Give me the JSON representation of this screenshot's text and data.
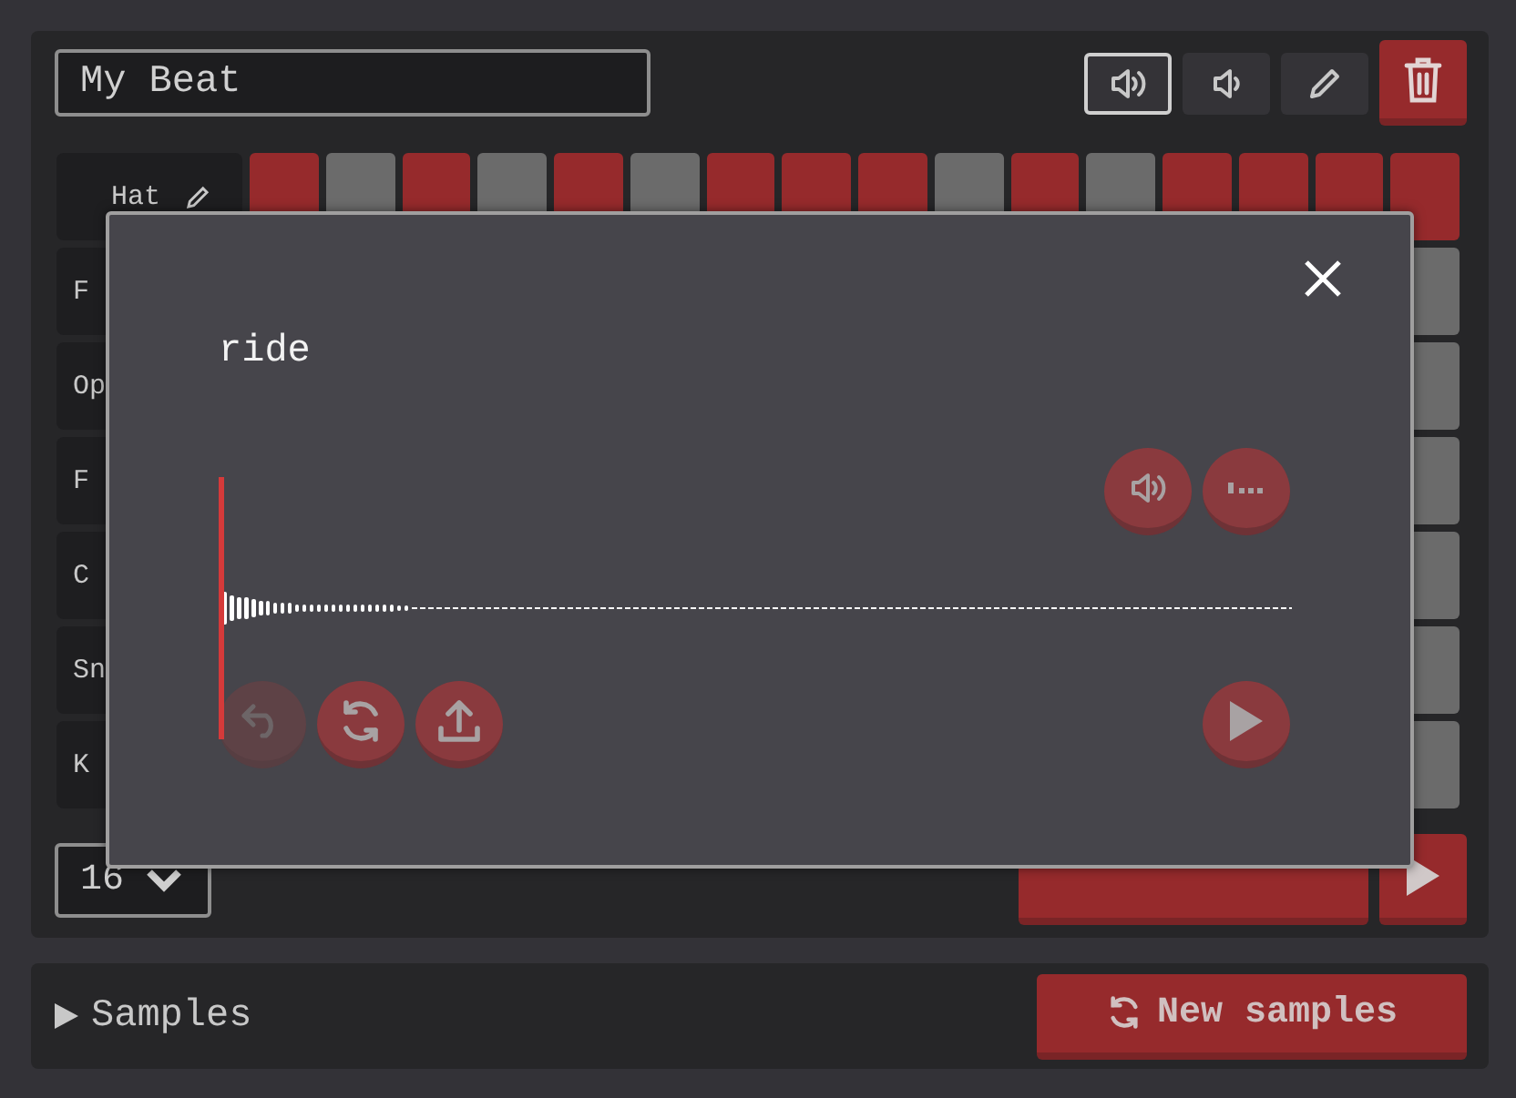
{
  "beat": {
    "name": "My Beat",
    "toolbar": [
      {
        "kind": "volume-high",
        "selected": true
      },
      {
        "kind": "volume-low",
        "selected": false
      },
      {
        "kind": "pencil",
        "selected": false
      }
    ],
    "tracks": [
      {
        "label": "Hat",
        "edit_icon": true,
        "steps": [
          true,
          false,
          true,
          false,
          true,
          false,
          true,
          true,
          true,
          false,
          true,
          false,
          true,
          true,
          true,
          true
        ]
      },
      {
        "label": "F",
        "edit_icon": false,
        "steps": [
          false
        ]
      },
      {
        "label": "Op",
        "edit_icon": false,
        "steps": [
          false
        ]
      },
      {
        "label": "F",
        "edit_icon": false,
        "steps": [
          false
        ]
      },
      {
        "label": "C",
        "edit_icon": false,
        "steps": [
          false
        ]
      },
      {
        "label": "Sn",
        "edit_icon": false,
        "steps": [
          false
        ]
      },
      {
        "label": "K",
        "edit_icon": false,
        "steps": [
          false
        ]
      }
    ],
    "step_count": "16"
  },
  "samples": {
    "label": "Samples",
    "expanded": false,
    "new_samples_button": "New samples"
  },
  "sample_dialog": {
    "name": "ride",
    "actions": [
      {
        "kind": "undo",
        "disabled": true
      },
      {
        "kind": "refresh",
        "disabled": false
      },
      {
        "kind": "upload",
        "disabled": false
      }
    ]
  }
}
